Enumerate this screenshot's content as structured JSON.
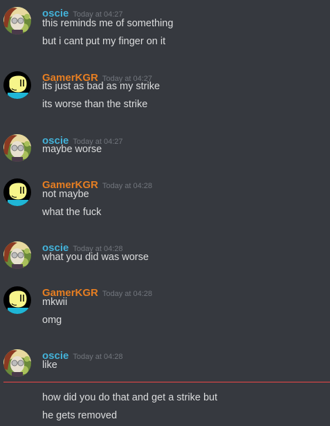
{
  "colors": {
    "oscie": "#43b2d9",
    "GamerKGR": "#e67e22",
    "new_divider": "#f04747"
  },
  "groups": [
    {
      "author": "oscie",
      "avatar": "oscie-avatar",
      "timestamp": "Today at 04:27",
      "messages": [
        "this reminds me of something",
        "but i cant put my finger on it"
      ]
    },
    {
      "author": "GamerKGR",
      "avatar": "gamerkgr-avatar",
      "timestamp": "Today at 04:27",
      "messages": [
        "its just as bad as my strike",
        "its worse than the strike"
      ]
    },
    {
      "author": "oscie",
      "avatar": "oscie-avatar",
      "timestamp": "Today at 04:27",
      "messages": [
        "maybe worse"
      ]
    },
    {
      "author": "GamerKGR",
      "avatar": "gamerkgr-avatar",
      "timestamp": "Today at 04:28",
      "messages": [
        "not maybe",
        "what the fuck"
      ]
    },
    {
      "author": "oscie",
      "avatar": "oscie-avatar",
      "timestamp": "Today at 04:28",
      "messages": [
        "what you did was worse"
      ]
    },
    {
      "author": "GamerKGR",
      "avatar": "gamerkgr-avatar",
      "timestamp": "Today at 04:28",
      "messages": [
        "mkwii",
        "omg"
      ]
    },
    {
      "author": "oscie",
      "avatar": "oscie-avatar",
      "timestamp": "Today at 04:28",
      "messages": [
        "like",
        "how did you do that and get a strike but",
        "he gets removed"
      ]
    }
  ]
}
